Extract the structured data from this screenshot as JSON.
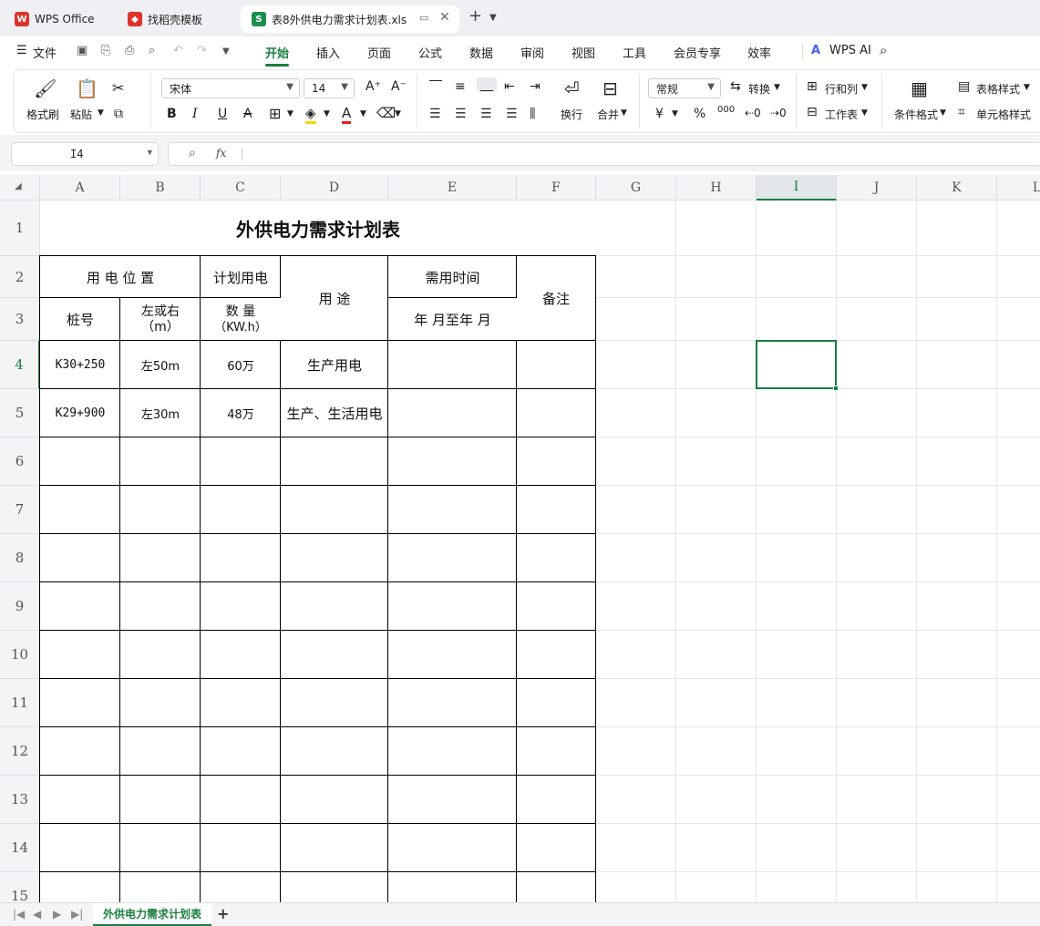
{
  "tabs": [
    {
      "label": "WPS Office",
      "icon": "wps-logo-icon",
      "color": "#e0322c"
    },
    {
      "label": "找稻壳模板",
      "icon": "docer-icon",
      "color": "#e0322c"
    },
    {
      "label": "表8外供电力需求计划表.xls",
      "icon": "spreadsheet-icon",
      "color": "#1a8f4e"
    }
  ],
  "menu": {
    "file": "文件",
    "items": [
      "开始",
      "插入",
      "页面",
      "公式",
      "数据",
      "审阅",
      "视图",
      "工具",
      "会员专享",
      "效率"
    ],
    "active": "开始",
    "wps_ai": "WPS AI"
  },
  "ribbon": {
    "format_painter": "格式刷",
    "paste": "粘贴",
    "font_name": "宋体",
    "font_size": "14",
    "wrap": "换行",
    "merge": "合并",
    "number_format": "常规",
    "convert": "转换",
    "rows_cols": "行和列",
    "worksheet": "工作表",
    "cond_format": "条件格式",
    "table_style": "表格样式",
    "cell_style": "单元格样式",
    "bold": "B",
    "italic": "I",
    "underline": "U",
    "strike": "A",
    "currency": "¥",
    "percent": "%",
    "thousands": "000"
  },
  "formula_bar": {
    "name_box": "I4",
    "fx": "fx",
    "formula": ""
  },
  "columns": [
    "A",
    "B",
    "C",
    "D",
    "E",
    "F",
    "G",
    "H",
    "I",
    "J",
    "K",
    "L"
  ],
  "active_col": "I",
  "active_row": "4",
  "rows": [
    "1",
    "2",
    "3",
    "4",
    "5",
    "6",
    "7",
    "8",
    "9",
    "10",
    "11",
    "12",
    "13",
    "14",
    "15"
  ],
  "sheet": {
    "title": "外供电力需求计划表",
    "h_location": "用 电 位 置",
    "h_plan": "计划用电",
    "h_use": "用  途",
    "h_time": "需用时间",
    "h_note": "备注",
    "h_pile": "桩号",
    "h_side": "左或右",
    "h_side_unit": "（m）",
    "h_qty": "数  量",
    "h_qty_unit": "（KW.h）",
    "h_time_range": "年  月至年  月",
    "data": [
      {
        "pile": "K30+250",
        "side": "左50m",
        "qty": "60万",
        "use": "生产用电",
        "time": "",
        "note": ""
      },
      {
        "pile": "K29+900",
        "side": "左30m",
        "qty": "48万",
        "use": "生产、生活用电",
        "time": "",
        "note": ""
      }
    ]
  },
  "sheet_tabs": {
    "active": "外供电力需求计划表",
    "add": "+"
  },
  "colors": {
    "accent": "#1a7f3f",
    "header_bg": "#f3f4f6"
  }
}
